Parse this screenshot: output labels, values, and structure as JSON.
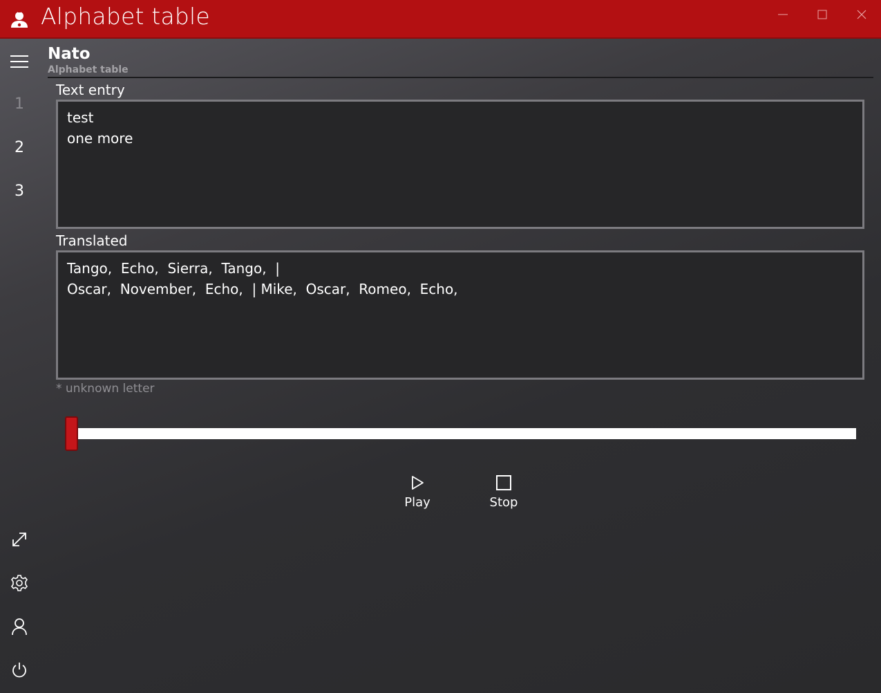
{
  "window": {
    "title": "Alphabet table"
  },
  "rail": {
    "items": [
      {
        "label": "1"
      },
      {
        "label": "2"
      },
      {
        "label": "3"
      }
    ],
    "bottom_icons": [
      "expand-icon",
      "gear-icon",
      "person-icon",
      "power-icon"
    ]
  },
  "header": {
    "title": "Nato",
    "subtitle": "Alphabet table"
  },
  "text_entry": {
    "label": "Text entry",
    "value": "test\none more"
  },
  "translated": {
    "label": "Translated",
    "value": "Tango,  Echo,  Sierra,  Tango,  |\nOscar,  November,  Echo,  | Mike,  Oscar,  Romeo,  Echo,"
  },
  "note": "* unknown letter",
  "slider": {
    "value_fraction": 0.0
  },
  "controls": {
    "play_label": "Play",
    "stop_label": "Stop"
  },
  "colors": {
    "accent": "#b31012",
    "background": "#2b2b2d",
    "text": "#ffffff"
  }
}
